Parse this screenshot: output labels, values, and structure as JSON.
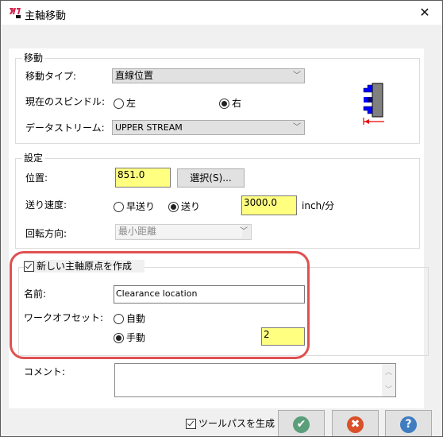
{
  "window": {
    "title": "主軸移動",
    "logo_icon": "app-logo-icon",
    "close_label": "✕"
  },
  "move_group": {
    "legend": "移動",
    "move_type_label": "移動タイプ:",
    "move_type_value": "直線位置",
    "current_spindle_label": "現在のスピンドル:",
    "spindle_options": [
      {
        "label": "左",
        "selected": false
      },
      {
        "label": "右",
        "selected": true
      }
    ],
    "data_stream_label": "データストリーム:",
    "data_stream_value": "UPPER STREAM"
  },
  "settings_group": {
    "legend": "設定",
    "position_label": "位置:",
    "position_value": "851.0",
    "select_button": "選択(S)...",
    "feed_label": "送り速度:",
    "feed_options": [
      {
        "label": "早送り",
        "selected": false
      },
      {
        "label": "送り",
        "selected": true
      }
    ],
    "feed_value": "3000.0",
    "feed_unit": "inch/分",
    "rotation_label": "回転方向:",
    "rotation_value": "最小距離"
  },
  "origin_group": {
    "checkbox_label": "新しい主軸原点を作成",
    "checked": true,
    "name_label": "名前:",
    "name_value": "Clearance location",
    "work_offset_label": "ワークオフセット:",
    "offset_options": [
      {
        "label": "自動",
        "selected": false
      },
      {
        "label": "手動",
        "selected": true
      }
    ],
    "offset_value": "2"
  },
  "comment": {
    "label": "コメント:",
    "value": ""
  },
  "footer": {
    "generate_toolpath_label": "ツールパスを生成",
    "generate_toolpath_checked": true,
    "ok_icon": "✔",
    "cancel_icon": "✖",
    "help_icon": "?",
    "colors": {
      "ok": "#5a9e7a",
      "cancel": "#d9502a",
      "help": "#3f7cc0"
    }
  }
}
